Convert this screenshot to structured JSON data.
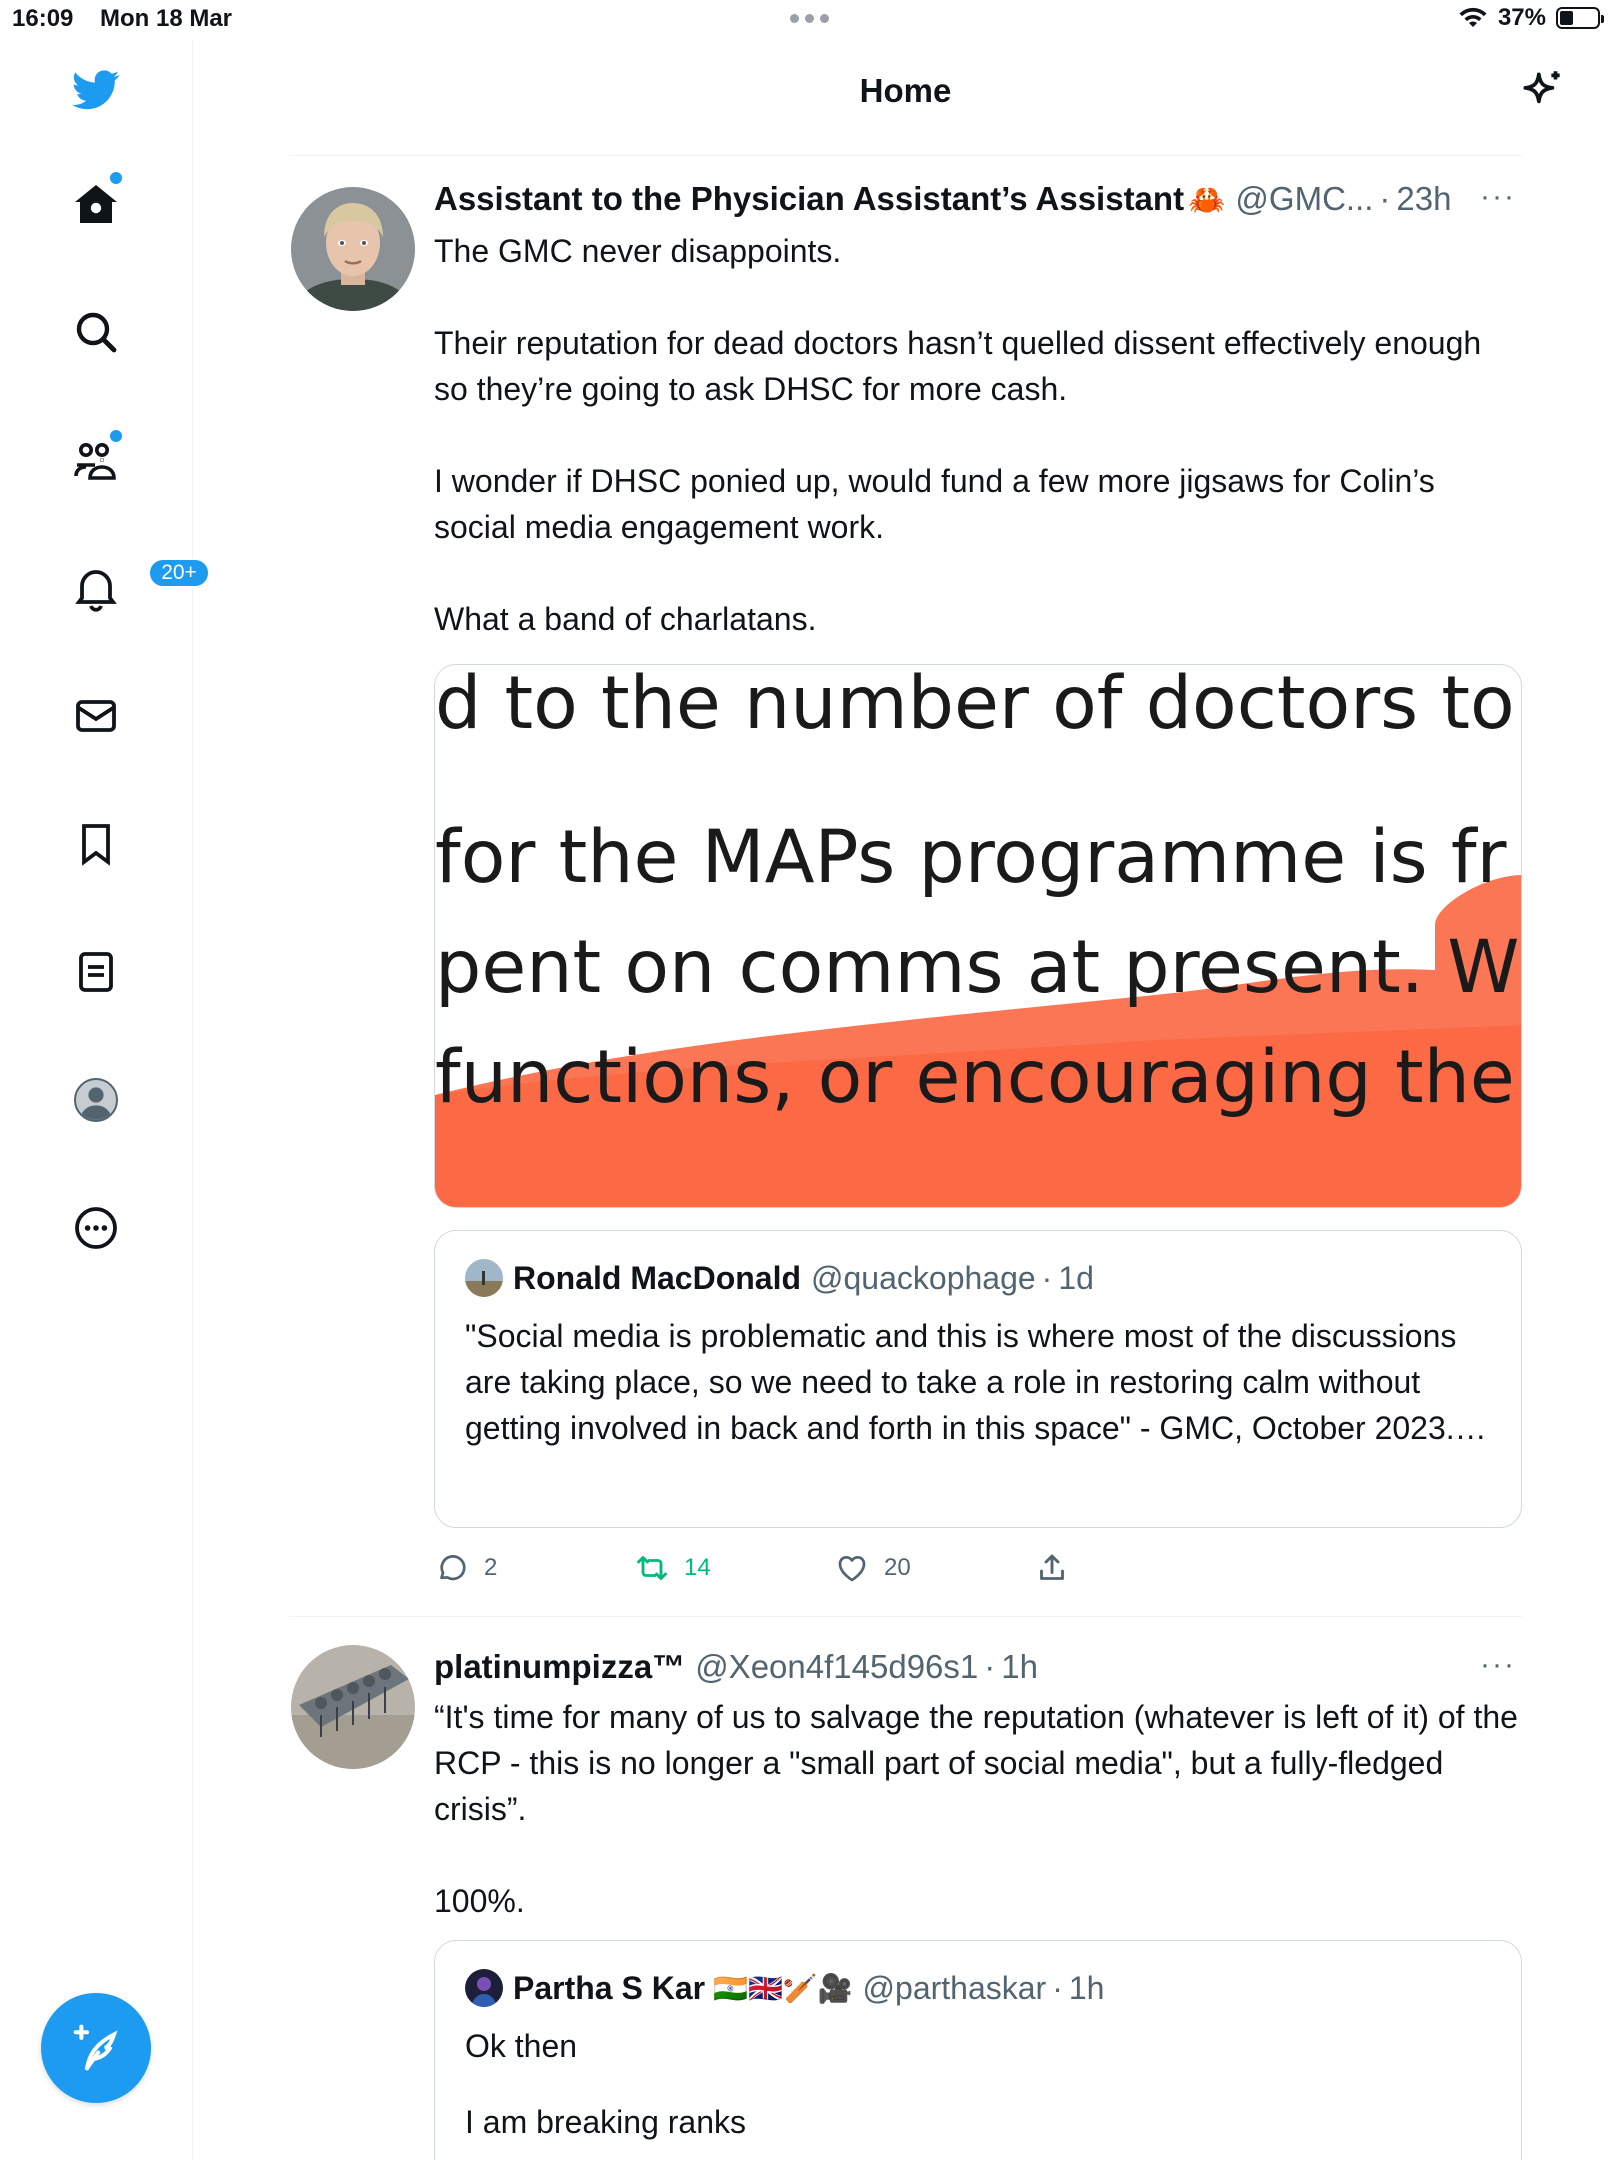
{
  "status_bar": {
    "time": "16:09",
    "date": "Mon 18 Mar",
    "battery": "37%",
    "battery_level": 0.37
  },
  "sidebar": {
    "items": [
      {
        "name": "home-icon",
        "label": "Home",
        "has_dot": true
      },
      {
        "name": "search-icon",
        "label": "Explore"
      },
      {
        "name": "communities-icon",
        "label": "Communities",
        "has_dot": true
      },
      {
        "name": "notifications-icon",
        "label": "Notifications",
        "badge": "20+"
      },
      {
        "name": "messages-icon",
        "label": "Messages"
      },
      {
        "name": "bookmarks-icon",
        "label": "Bookmarks"
      },
      {
        "name": "lists-icon",
        "label": "Lists"
      },
      {
        "name": "profile-icon",
        "label": "Profile"
      },
      {
        "name": "more-icon",
        "label": "More"
      }
    ],
    "notification_badge": "20+",
    "accent": "#1d9bf0"
  },
  "header": {
    "title": "Home"
  },
  "tweets": [
    {
      "name": "Assistant to the Physician Assistant’s Assistant",
      "name_emoji": "🦀",
      "handle": "@GMC...",
      "time": "23h",
      "more": "···",
      "text": [
        "The GMC never disappoints.",
        "",
        "Their reputation for dead doctors hasn’t quelled dissent effectively enough so they’re going to ask DHSC for more cash.",
        "",
        "I wonder if DHSC ponied up, would fund a few more jigsaws for Colin’s social media engagement work.",
        "",
        "What a band of charlatans."
      ],
      "media": {
        "lines": [
          "d to the number of doctors to",
          "for the MAPs programme is fr",
          "pent on comms at present. W",
          "functions, or encouraging ther"
        ],
        "highlight_color": "#fb6a45"
      },
      "quote": {
        "name": "Ronald MacDonald",
        "handle": "@quackophage",
        "time": "1d",
        "text": "\"Social media is problematic and this is where most of the discussions are taking place, so we need to take a role in restoring calm without getting involved in back and forth in this space\" - GMC, October 2023.…"
      },
      "actions": {
        "replies": "2",
        "retweets": "14",
        "likes": "20"
      }
    },
    {
      "name": "platinumpizza™",
      "handle": "@Xeon4f145d96s1",
      "time": "1h",
      "more": "···",
      "text": [
        "“It's time for many of us to salvage the reputation (whatever is left of it) of the RCP - this is no longer a \"small part of social media\", but a fully-fledged crisis”.",
        "",
        "100%."
      ],
      "quote": {
        "name": "Partha S Kar",
        "name_emoji": "🇮🇳🇬🇧🏏🎥",
        "handle": "@parthaskar",
        "time": "1h",
        "text_lines": [
          "Ok then",
          "",
          "I am breaking ranks"
        ]
      }
    }
  ],
  "separator": "·"
}
